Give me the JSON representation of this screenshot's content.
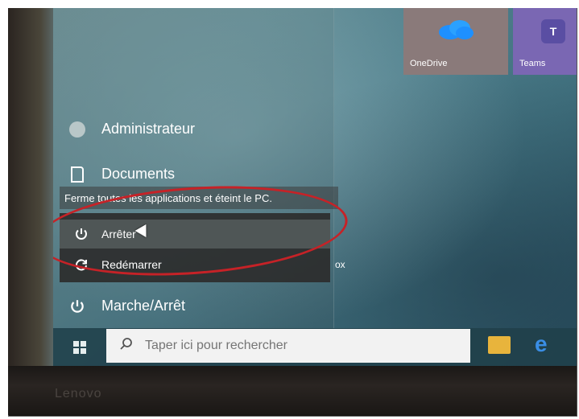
{
  "tiles": {
    "onedrive": {
      "label": "OneDrive",
      "color": "#8a7a7a"
    },
    "teams": {
      "label": "Teams",
      "color": "#7a67b3"
    }
  },
  "start_menu": {
    "user": "Administrateur",
    "documents": "Documents",
    "power": "Marche/Arrêt"
  },
  "tooltip": "Ferme toutes les applications et éteint le PC.",
  "power_submenu": {
    "items": [
      {
        "label": "Arrêter",
        "icon": "power-icon",
        "highlighted": true
      },
      {
        "label": "Redémarrer",
        "icon": "restart-icon",
        "highlighted": false
      }
    ],
    "overflow_text": "ox"
  },
  "taskbar": {
    "search_placeholder": "Taper ici pour rechercher"
  },
  "annotation": {
    "color": "#c62227"
  },
  "device_brand": "Lenovo"
}
